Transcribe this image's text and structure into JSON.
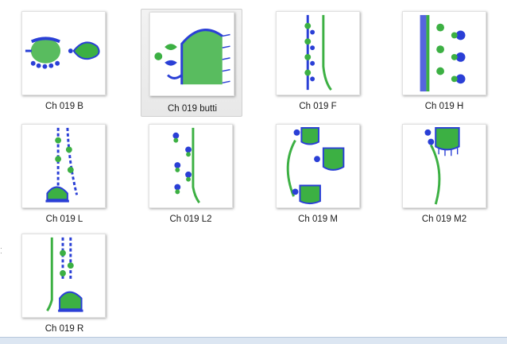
{
  "files": [
    {
      "label": "Ch 019 B",
      "icon": "embroidery-thumb-b"
    },
    {
      "label": "Ch 019 butti",
      "icon": "embroidery-thumb-butti",
      "selected": true
    },
    {
      "label": "Ch 019 F",
      "icon": "embroidery-thumb-f"
    },
    {
      "label": "Ch 019 H",
      "icon": "embroidery-thumb-h"
    },
    {
      "label": "Ch 019 L",
      "icon": "embroidery-thumb-l"
    },
    {
      "label": "Ch 019 L2",
      "icon": "embroidery-thumb-l2"
    },
    {
      "label": "Ch 019 M",
      "icon": "embroidery-thumb-m"
    },
    {
      "label": "Ch 019 M2",
      "icon": "embroidery-thumb-m2"
    },
    {
      "label": "Ch 019 R",
      "icon": "embroidery-thumb-r"
    }
  ],
  "colors": {
    "blue": "#2a3fd6",
    "green": "#3cb043",
    "selection": "#e8e8e8"
  }
}
